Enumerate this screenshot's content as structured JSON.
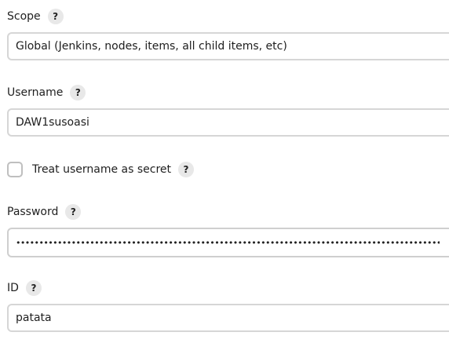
{
  "scope": {
    "label": "Scope",
    "help": "?",
    "value": "Global (Jenkins, nodes, items, all child items, etc)"
  },
  "username": {
    "label": "Username",
    "help": "?",
    "value": "DAW1susoasi"
  },
  "treat_username_secret": {
    "label": "Treat username as secret",
    "help": "?",
    "checked": false
  },
  "password": {
    "label": "Password",
    "help": "?",
    "masked_value": "••••••••••••••••••••••••••••••••••••••••••••••••••••••••••••••••••••••••••••••••••••••••••••••••••••••••"
  },
  "id": {
    "label": "ID",
    "help": "?",
    "value": "patata"
  },
  "icons": {
    "help": "question-mark-help-icon"
  }
}
